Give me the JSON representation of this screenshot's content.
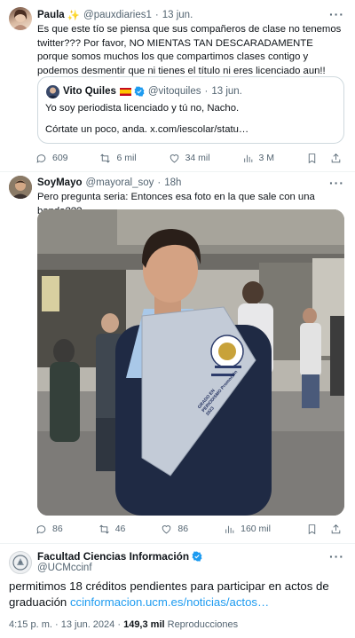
{
  "tweet1": {
    "name": "Paula",
    "emoji": "✨",
    "handle": "@pauxdiaries1",
    "sep": "·",
    "time": "13 jun.",
    "text": "Es que este tío se piensa que sus compañeros de clase no tenemos twitter??? Por favor, NO MIENTAS TAN DESCARADAMENTE porque somos muchos los que compartimos clases contigo y podemos desmentir que ni tienes el título ni eres licenciado aun!!",
    "quote": {
      "name": "Vito Quiles",
      "handle": "@vitoquiles",
      "time": "13 jun.",
      "line1": "Yo soy periodista licenciado y tú no, Nacho.",
      "line2": "Córtate un poco, anda. x.com/iescolar/statu…"
    },
    "stats": {
      "replies": "609",
      "retweets": "6 mil",
      "likes": "34 mil",
      "views": "3 M"
    }
  },
  "tweet2": {
    "name": "SoyMayo",
    "handle": "@mayoral_soy",
    "sep": "·",
    "time": "18h",
    "text": "Pero pregunta seria: Entonces esa foto en la que sale con una banda???",
    "photo_sash_text": "GRADO EN PERIODISMO Promoción 2023",
    "stats": {
      "replies": "86",
      "retweets": "46",
      "likes": "86",
      "views": "160 mil"
    }
  },
  "tweet3": {
    "name": "Facultad Ciencias Información",
    "handle": "@UCMccinf",
    "text": "permitimos 18 créditos pendientes para participar en  actos de graduación",
    "link": "ccinformacion.ucm.es/noticias/actos…",
    "time": "4:15 p. m.",
    "date": "13 jun. 2024",
    "views": "149,3 mil",
    "views_label": "Reproducciones"
  },
  "more_label": "···",
  "colors": {
    "link": "#1d9bf0",
    "muted": "#536471",
    "verified": "#1d9bf0",
    "border": "#cfd9de"
  }
}
